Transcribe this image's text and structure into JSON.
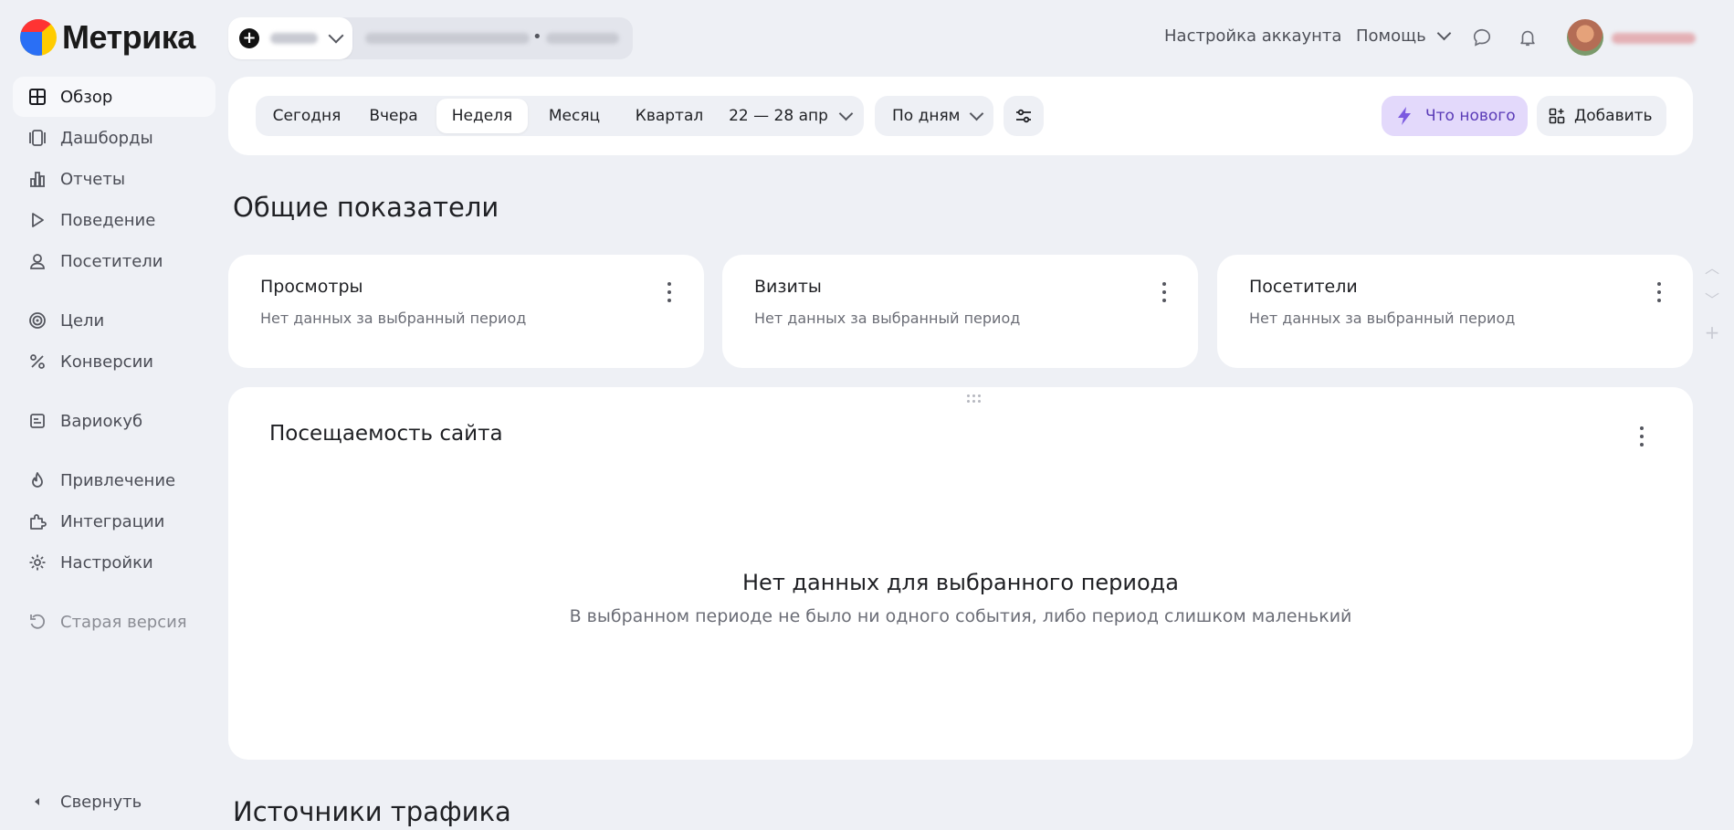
{
  "app": {
    "name": "Метрика"
  },
  "header": {
    "account_settings": "Настройка аккаунта",
    "help": "Помощь"
  },
  "sidebar": {
    "items": [
      {
        "label": "Обзор"
      },
      {
        "label": "Дашборды"
      },
      {
        "label": "Отчеты"
      },
      {
        "label": "Поведение"
      },
      {
        "label": "Посетители"
      },
      {
        "label": "Цели"
      },
      {
        "label": "Конверсии"
      },
      {
        "label": "Вариокуб"
      },
      {
        "label": "Привлечение"
      },
      {
        "label": "Интеграции"
      },
      {
        "label": "Настройки"
      },
      {
        "label": "Старая версия"
      }
    ],
    "collapse_label": "Свернуть"
  },
  "toolbar": {
    "periods": [
      "Сегодня",
      "Вчера",
      "Неделя",
      "Месяц",
      "Квартал"
    ],
    "selected_period": "Неделя",
    "date_range": "22 — 28 апр",
    "grouping": "По дням",
    "whats_new": "Что нового",
    "add": "Добавить"
  },
  "main": {
    "section_title": "Общие показатели",
    "metrics": [
      {
        "title": "Просмотры",
        "note": "Нет данных за выбранный период"
      },
      {
        "title": "Визиты",
        "note": "Нет данных за выбранный период"
      },
      {
        "title": "Посетители",
        "note": "Нет данных за выбранный период"
      }
    ],
    "traffic_card": {
      "title": "Посещаемость сайта",
      "empty_title": "Нет данных для выбранного периода",
      "empty_sub": "В выбранном периоде не было ни одного события, либо период слишком маленький"
    },
    "next_section_title": "Источники трафика"
  },
  "colors": {
    "background": "#eef0f5",
    "card": "#ffffff",
    "accent_purple": "#5a3bb7",
    "accent_purple_bg": "#e3d9fb"
  }
}
